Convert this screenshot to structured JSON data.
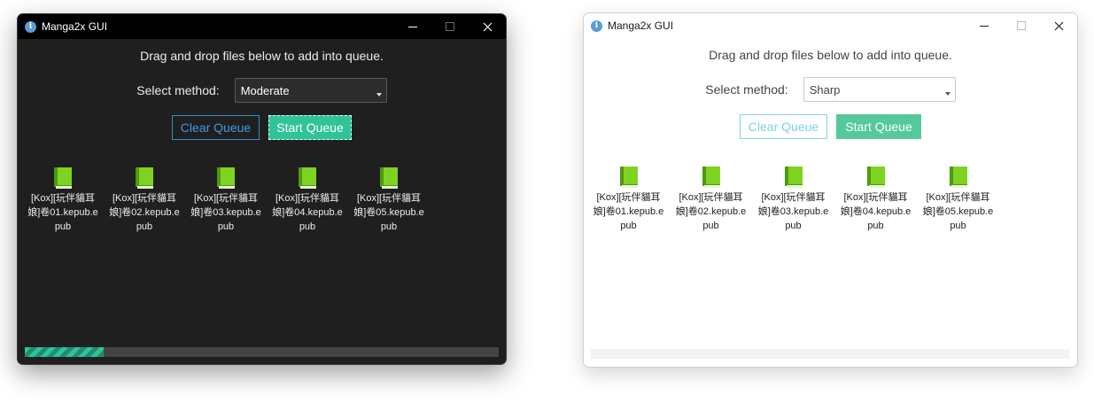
{
  "windows": [
    {
      "theme": "dark",
      "title": "Manga2x GUI",
      "instruction": "Drag and drop files below to add into queue.",
      "method_label": "Select method:",
      "method_value": "Moderate",
      "clear_label": "Clear Queue",
      "start_label": "Start Queue",
      "files": [
        "[Kox][玩伴貓耳娘]卷01.kepub.epub",
        "[Kox][玩伴貓耳娘]卷02.kepub.epub",
        "[Kox][玩伴貓耳娘]卷03.kepub.epub",
        "[Kox][玩伴貓耳娘]卷04.kepub.epub",
        "[Kox][玩伴貓耳娘]卷05.kepub.epub"
      ],
      "progress": 0.166
    },
    {
      "theme": "light",
      "title": "Manga2x GUI",
      "instruction": "Drag and drop files below to add into queue.",
      "method_label": "Select method:",
      "method_value": "Sharp",
      "clear_label": "Clear Queue",
      "start_label": "Start Queue",
      "files": [
        "[Kox][玩伴貓耳娘]卷01.kepub.epub",
        "[Kox][玩伴貓耳娘]卷02.kepub.epub",
        "[Kox][玩伴貓耳娘]卷03.kepub.epub",
        "[Kox][玩伴貓耳娘]卷04.kepub.epub",
        "[Kox][玩伴貓耳娘]卷05.kepub.epub"
      ],
      "progress": 0
    }
  ],
  "icons": {
    "app": "info-icon",
    "file": "green-book-icon",
    "minimize": "minimize-icon",
    "maximize": "maximize-icon",
    "close": "close-icon"
  },
  "colors": {
    "accent_green": "#2fc39a",
    "accent_blue": "#3a9ee0",
    "book_green": "#7ed321"
  }
}
